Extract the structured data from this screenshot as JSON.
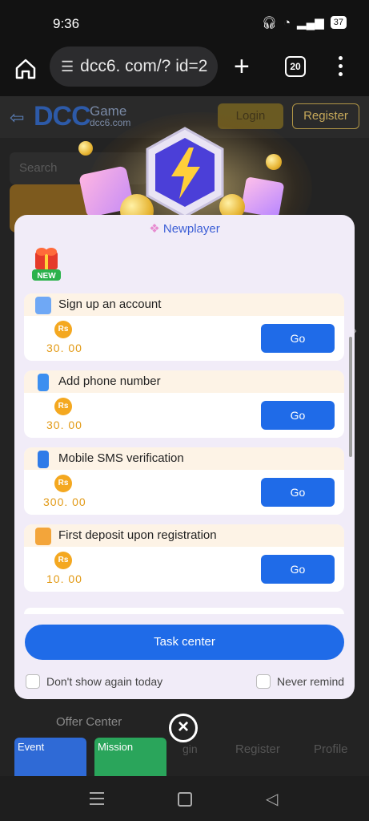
{
  "status_bar": {
    "time": "9:36",
    "battery": "37"
  },
  "browser": {
    "url": "dcc6. com/? id=2",
    "tab_count": "20"
  },
  "site": {
    "logo": "DCC",
    "logo_game": "Game",
    "logo_domain": "dcc6.com",
    "login_label": "Login",
    "register_label": "Register",
    "search_placeholder": "Search",
    "offer_center": "Offer Center",
    "event_label": "Event",
    "mission_label": "Mission",
    "nav": {
      "login": "gin",
      "register": "Register",
      "profile": "Profile"
    }
  },
  "modal": {
    "title": "Newplayer",
    "new_badge": "NEW",
    "tasks": [
      {
        "title": "Sign up an account",
        "amount": "30. 00",
        "button": "Go",
        "icon_color": "#6fa8f5"
      },
      {
        "title": "Add phone number",
        "amount": "30. 00",
        "button": "Go",
        "icon_color": "#3c8ff0"
      },
      {
        "title": "Mobile SMS verification",
        "amount": "300. 00",
        "button": "Go",
        "icon_color": "#2f7be8"
      },
      {
        "title": "First deposit upon registration",
        "amount": "10. 00",
        "button": "Go",
        "icon_color": "#f3a53a"
      }
    ],
    "currency": "Rs",
    "task_center_label": "Task center",
    "dont_show_label": "Don't show again today",
    "never_remind_label": "Never remind"
  },
  "colors": {
    "accent": "#1f6be8",
    "amount": "#e29a16",
    "modal_bg": "#f1ecf8"
  }
}
